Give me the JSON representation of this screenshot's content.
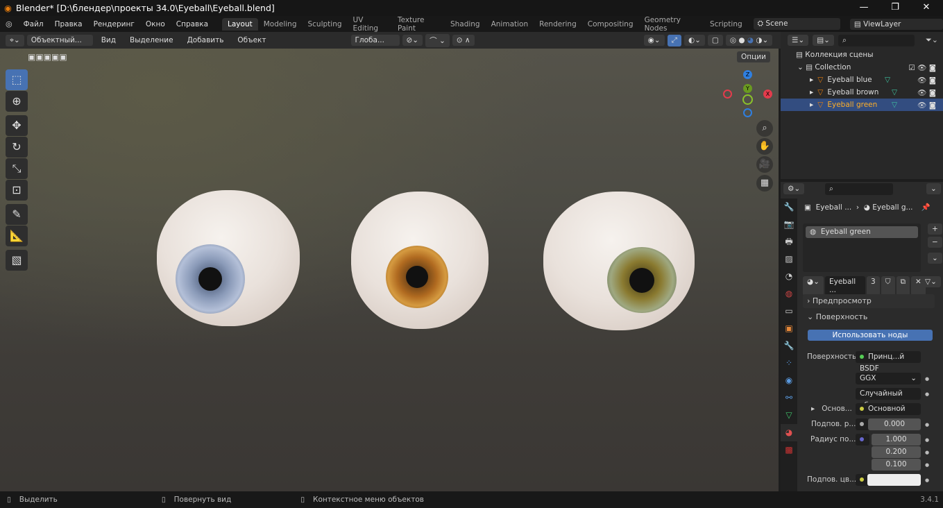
{
  "title": "Blender* [D:\\блендер\\проекты 34.0\\Eyeball\\Eyeball.blend]",
  "menu": [
    "Файл",
    "Правка",
    "Рендеринг",
    "Окно",
    "Справка"
  ],
  "workspaces": [
    "Layout",
    "Modeling",
    "Sculpting",
    "UV Editing",
    "Texture Paint",
    "Shading",
    "Animation",
    "Rendering",
    "Compositing",
    "Geometry Nodes",
    "Scripting"
  ],
  "scene": "Scene",
  "view_layer": "ViewLayer",
  "viewport_header": {
    "mode": "Объектный...",
    "menus": [
      "Вид",
      "Выделение",
      "Добавить",
      "Объект"
    ],
    "orientation": "Глоба...",
    "options": "Опции"
  },
  "gizmo": {
    "z": "Z",
    "y": "Y",
    "x": "X"
  },
  "outliner": {
    "scene_collection": "Коллекция сцены",
    "collection": "Collection",
    "items": [
      "Eyeball blue",
      "Eyeball brown",
      "Eyeball green"
    ]
  },
  "props": {
    "breadcrumb_obj": "Eyeball ...",
    "breadcrumb_mat": "Eyeball g...",
    "slot": "Eyeball green",
    "mat_name": "Eyeball ...",
    "users": "3",
    "preview": "Предпросмотр",
    "surface_panel": "Поверхность",
    "use_nodes": "Использовать ноды",
    "surface_label": "Поверхность",
    "surface_value": "Принц...й BSDF",
    "dist": "GGX",
    "sss_method": "Случайный об...",
    "base_label": "Основ...",
    "base_value": "Основной цвет",
    "sub_label": "Подпов. р...",
    "sub_value": "0.000",
    "radius_label": "Радиус по...",
    "radius": [
      "1.000",
      "0.200",
      "0.100"
    ],
    "subcol_label": "Подпов. цв..."
  },
  "status": {
    "select": "Выделить",
    "rotate": "Повернуть вид",
    "context": "Контекстное меню объектов",
    "version": "3.4.1"
  },
  "colors": {
    "accent": "#4772b3",
    "selected": "#334d80"
  }
}
